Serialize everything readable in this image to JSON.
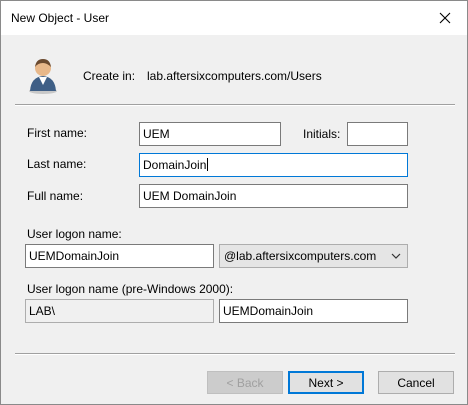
{
  "window": {
    "title": "New Object - User",
    "close_label": "✕"
  },
  "header": {
    "create_in_label": "Create in:",
    "create_in_value": "lab.aftersixcomputers.com/Users"
  },
  "form": {
    "first_name_label": "First name:",
    "first_name_value": "UEM",
    "initials_label": "Initials:",
    "initials_value": "",
    "last_name_label": "Last name:",
    "last_name_value": "DomainJoin",
    "full_name_label": "Full name:",
    "full_name_value": "UEM DomainJoin",
    "logon_name_label": "User logon name:",
    "logon_name_value": "UEMDomainJoin",
    "upn_suffix_value": "@lab.aftersixcomputers.com",
    "pre2000_label": "User logon name (pre-Windows 2000):",
    "pre2000_domain_value": "LAB\\",
    "pre2000_name_value": "UEMDomainJoin"
  },
  "buttons": {
    "back_label": "< Back",
    "next_label": "Next >",
    "cancel_label": "Cancel"
  },
  "colors": {
    "focus_border": "#0078d7",
    "dialog_bg": "#f0f0f0"
  },
  "icons": {
    "avatar": "user-icon",
    "close": "close-icon",
    "dropdown": "chevron-down-icon"
  }
}
